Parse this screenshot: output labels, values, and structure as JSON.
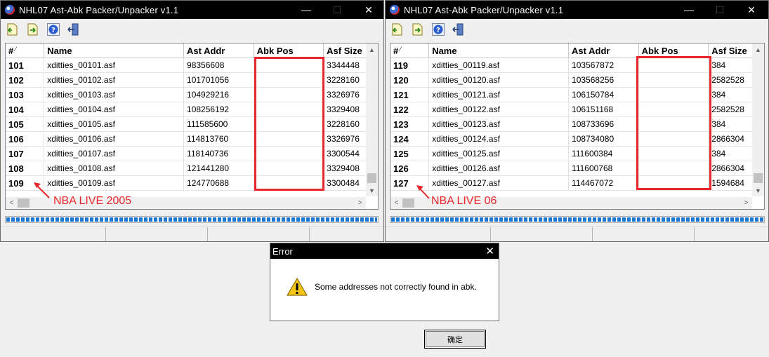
{
  "windows": [
    {
      "title": "NHL07 Ast-Abk Packer/Unpacker v1.1",
      "columns": [
        "#",
        "Name",
        "Ast Addr",
        "Abk Pos",
        "Asf Size"
      ],
      "rows": [
        {
          "idx": "101",
          "name": "xditties_00101.asf",
          "addr": "98356608",
          "abk": "",
          "size": "3344448"
        },
        {
          "idx": "102",
          "name": "xditties_00102.asf",
          "addr": "101701056",
          "abk": "",
          "size": "3228160"
        },
        {
          "idx": "103",
          "name": "xditties_00103.asf",
          "addr": "104929216",
          "abk": "",
          "size": "3326976"
        },
        {
          "idx": "104",
          "name": "xditties_00104.asf",
          "addr": "108256192",
          "abk": "",
          "size": "3329408"
        },
        {
          "idx": "105",
          "name": "xditties_00105.asf",
          "addr": "111585600",
          "abk": "",
          "size": "3228160"
        },
        {
          "idx": "106",
          "name": "xditties_00106.asf",
          "addr": "114813760",
          "abk": "",
          "size": "3326976"
        },
        {
          "idx": "107",
          "name": "xditties_00107.asf",
          "addr": "118140736",
          "abk": "",
          "size": "3300544"
        },
        {
          "idx": "108",
          "name": "xditties_00108.asf",
          "addr": "121441280",
          "abk": "",
          "size": "3329408"
        },
        {
          "idx": "109",
          "name": "xditties_00109.asf",
          "addr": "124770688",
          "abk": "",
          "size": "3300484"
        }
      ],
      "annotation": "NBA LIVE 2005"
    },
    {
      "title": "NHL07 Ast-Abk Packer/Unpacker v1.1",
      "columns": [
        "#",
        "Name",
        "Ast Addr",
        "Abk Pos",
        "Asf Size"
      ],
      "rows": [
        {
          "idx": "119",
          "name": "xditties_00119.asf",
          "addr": "103567872",
          "abk": "",
          "size": "384"
        },
        {
          "idx": "120",
          "name": "xditties_00120.asf",
          "addr": "103568256",
          "abk": "",
          "size": "2582528"
        },
        {
          "idx": "121",
          "name": "xditties_00121.asf",
          "addr": "106150784",
          "abk": "",
          "size": "384"
        },
        {
          "idx": "122",
          "name": "xditties_00122.asf",
          "addr": "106151168",
          "abk": "",
          "size": "2582528"
        },
        {
          "idx": "123",
          "name": "xditties_00123.asf",
          "addr": "108733696",
          "abk": "",
          "size": "384"
        },
        {
          "idx": "124",
          "name": "xditties_00124.asf",
          "addr": "108734080",
          "abk": "",
          "size": "2866304"
        },
        {
          "idx": "125",
          "name": "xditties_00125.asf",
          "addr": "111600384",
          "abk": "",
          "size": "384"
        },
        {
          "idx": "126",
          "name": "xditties_00126.asf",
          "addr": "111600768",
          "abk": "",
          "size": "2866304"
        },
        {
          "idx": "127",
          "name": "xditties_00127.asf",
          "addr": "114467072",
          "abk": "",
          "size": "1594684"
        }
      ],
      "annotation": "NBA LIVE 06"
    }
  ],
  "titlebar_controls": {
    "minimize": "—",
    "maximize": "☐",
    "close": "✕"
  },
  "toolbar": [
    {
      "name": "open-ast-icon"
    },
    {
      "name": "save-ast-icon"
    },
    {
      "name": "help-icon"
    },
    {
      "name": "exit-icon"
    }
  ],
  "dialog": {
    "title": "Error",
    "close": "✕",
    "message": "Some addresses not correctly found in abk.",
    "ok_label": "确定"
  },
  "colors": {
    "accent_red": "#e8262b",
    "progress_blue": "#1976d2",
    "titlebar": "#000000"
  }
}
